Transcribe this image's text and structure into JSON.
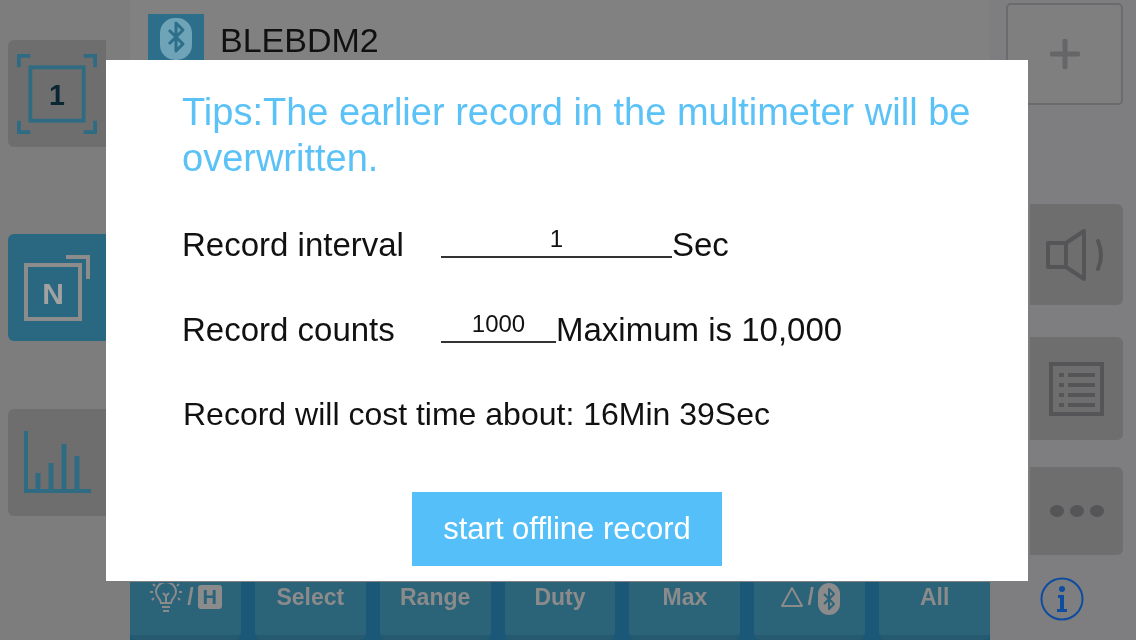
{
  "header": {
    "device_name": "BLEBDM2"
  },
  "left_sidebar": {
    "items": [
      {
        "kind": "single",
        "label": "1",
        "selected": false
      },
      {
        "kind": "multi",
        "label": "N",
        "selected": true
      },
      {
        "kind": "chart",
        "selected": false
      }
    ]
  },
  "right_sidebar": {
    "items": [
      {
        "kind": "add"
      },
      {
        "kind": "sound"
      },
      {
        "kind": "list"
      },
      {
        "kind": "more"
      },
      {
        "kind": "info"
      }
    ]
  },
  "dialog": {
    "tip": "Tips:The earlier record in the multimeter will be overwritten.",
    "fields": [
      {
        "label": "Record interval",
        "value": "1",
        "unit": "Sec"
      },
      {
        "label": "Record counts",
        "value": "1000",
        "unit": "Maximum is 10,000"
      }
    ],
    "estimate": "Record will cost time about: 16Min 39Sec",
    "button": "start offline record"
  },
  "function_keys": [
    {
      "kind": "light_hold",
      "separator": "/",
      "badge": "H"
    },
    {
      "kind": "text",
      "label": "Select"
    },
    {
      "kind": "text",
      "label": "Range"
    },
    {
      "kind": "text",
      "label": "Duty"
    },
    {
      "kind": "text",
      "label": "Max"
    },
    {
      "kind": "delta_bluetooth",
      "separator": "/"
    },
    {
      "kind": "text",
      "label": "All"
    }
  ]
}
